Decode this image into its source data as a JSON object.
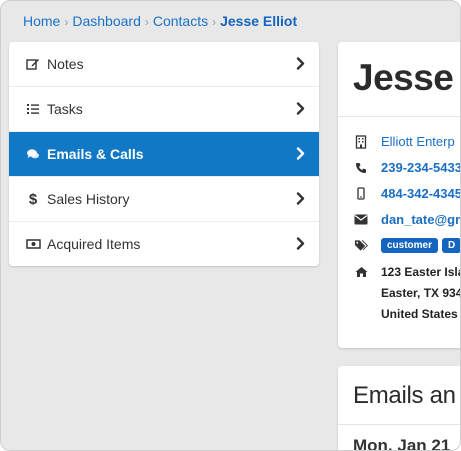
{
  "breadcrumb": {
    "items": [
      "Home",
      "Dashboard",
      "Contacts"
    ],
    "current": "Jesse Elliot"
  },
  "menu": {
    "items": [
      {
        "label": "Notes",
        "icon": "edit-icon"
      },
      {
        "label": "Tasks",
        "icon": "list-icon"
      },
      {
        "label": "Emails & Calls",
        "icon": "comments-icon",
        "active": true
      },
      {
        "label": "Sales History",
        "icon": "dollar-icon"
      },
      {
        "label": "Acquired Items",
        "icon": "money-icon"
      }
    ]
  },
  "contact": {
    "name": "Jesse",
    "company": "Elliott Enterp",
    "phone": "239-234-5433",
    "mobile": "484-342-4345",
    "email": "dan_tate@gm",
    "tags": [
      "customer",
      "D"
    ],
    "address": [
      "123 Easter Isla",
      "Easter, TX 934",
      "United States"
    ]
  },
  "section": {
    "title": "Emails an",
    "date": "Mon, Jan 21"
  },
  "colors": {
    "accent": "#1178c5",
    "link": "#1a6fc4",
    "tag": "#1565c0"
  }
}
